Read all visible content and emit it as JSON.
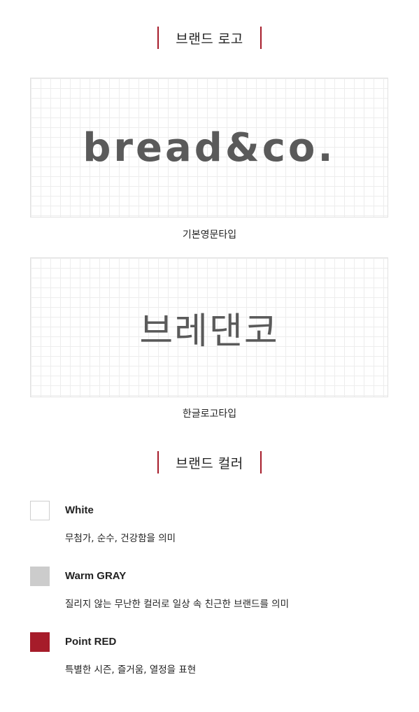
{
  "brand_logo_section": {
    "title": "브랜드 로고",
    "logos": [
      {
        "text": "bread&co.",
        "caption": "기본영문타입"
      },
      {
        "text": "브레댄코",
        "caption": "한글로고타입"
      }
    ]
  },
  "brand_color_section": {
    "title": "브랜드 컬러",
    "colors": [
      {
        "name": "White",
        "hex": "#ffffff",
        "description": "무첨가, 순수, 건강함을 의미"
      },
      {
        "name": "Warm GRAY",
        "hex": "#cccccc",
        "description": "질리지 않는 무난한 컬러로 일상 속 친근한 브랜드를 의미"
      },
      {
        "name": "Point RED",
        "hex": "#a61c2a",
        "description": "특별한 시즌, 즐거움, 열정을 표현"
      }
    ]
  },
  "accent_color": "#a61c2a"
}
